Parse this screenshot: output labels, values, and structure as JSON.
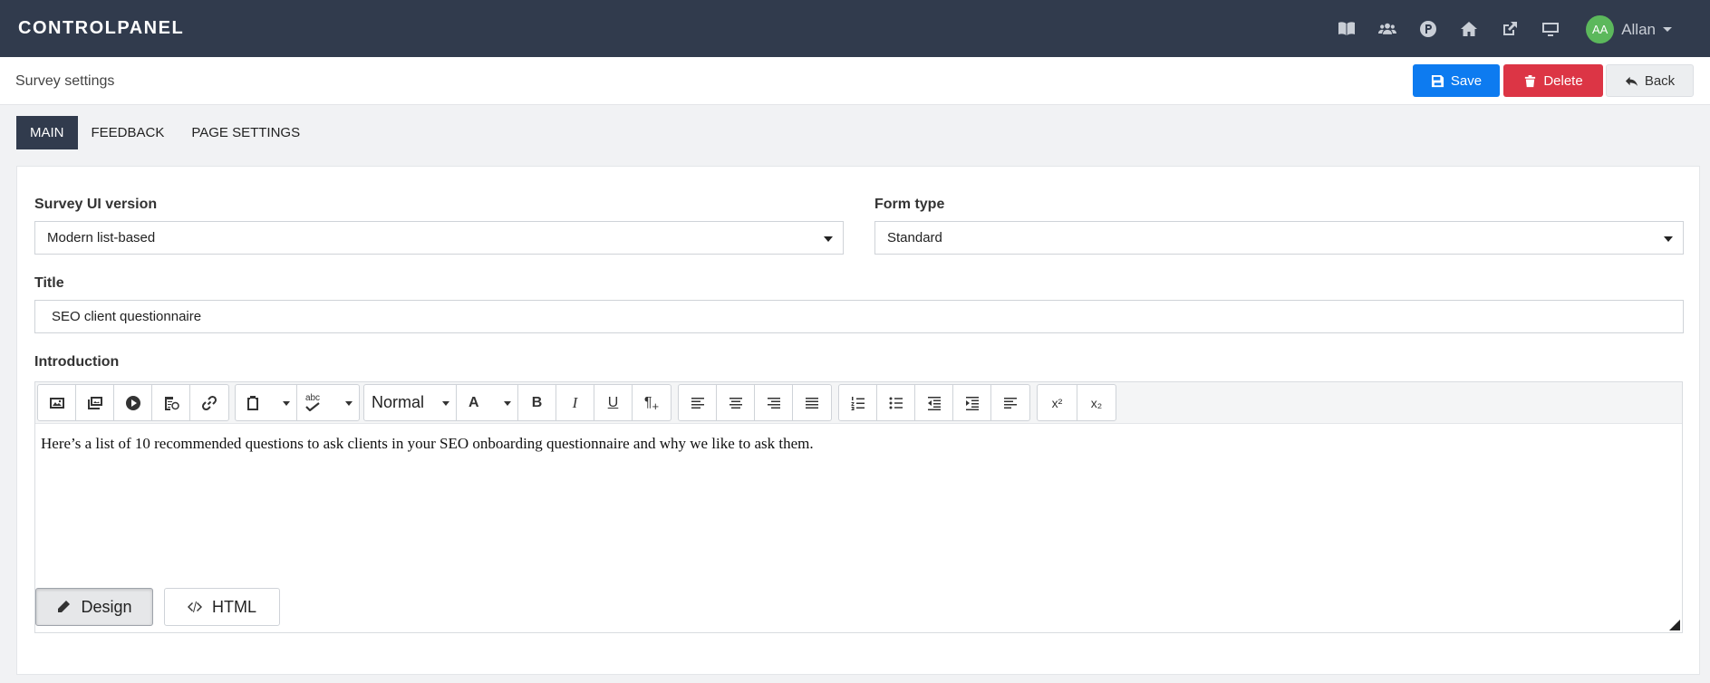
{
  "topbar": {
    "brand": "CONTROLPANEL",
    "icons": [
      "book-icon",
      "users-icon",
      "parking-icon",
      "home-icon",
      "external-link-icon",
      "monitor-icon"
    ],
    "user": {
      "initials": "AA",
      "name": "Allan"
    },
    "colors": {
      "background": "#313b4d",
      "avatar": "#5cb85c"
    }
  },
  "subbar": {
    "title": "Survey settings",
    "save_label": "Save",
    "delete_label": "Delete",
    "back_label": "Back",
    "colors": {
      "save": "#0d7bf0",
      "delete": "#dc3545"
    }
  },
  "tabs": [
    {
      "label": "MAIN",
      "active": true
    },
    {
      "label": "FEEDBACK",
      "active": false
    },
    {
      "label": "PAGE SETTINGS",
      "active": false
    }
  ],
  "form": {
    "survey_ui_version": {
      "label": "Survey UI version",
      "value": "Modern list-based"
    },
    "form_type": {
      "label": "Form type",
      "value": "Standard"
    },
    "title": {
      "label": "Title",
      "value": "SEO client questionnaire"
    },
    "introduction": {
      "label": "Introduction",
      "content": "Here’s a list of 10 recommended questions to ask clients in your SEO onboarding questionnaire and why we like to ask them.",
      "format_value": "Normal",
      "font_color_glyph": "A",
      "bold_glyph": "B",
      "italic_glyph": "I",
      "underline_glyph": "U",
      "paragraph_glyph": "¶",
      "spell_glyph": "abc",
      "superscript_glyph": "x²",
      "subscript_glyph": "x₂",
      "modes": [
        {
          "label": "Design",
          "active": true
        },
        {
          "label": "HTML",
          "active": false
        }
      ]
    }
  }
}
